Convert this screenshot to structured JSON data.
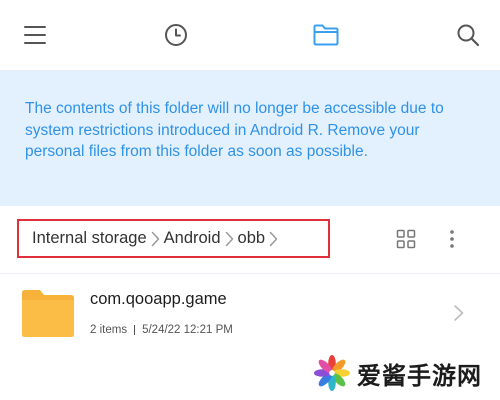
{
  "topbar": {
    "tabs": [
      {
        "icon": "menu-icon"
      },
      {
        "icon": "clock-icon"
      },
      {
        "icon": "folder-icon",
        "active": true
      },
      {
        "icon": "search-icon"
      }
    ],
    "accent_color": "#3aa0ee",
    "icon_color": "#555555"
  },
  "notice": {
    "text": "The contents of this folder will no longer be accessible due to system restrictions introduced in Android R. Remove your personal files from this folder as soon as possible.",
    "background": "#e3f0fd",
    "text_color": "#2f92e6"
  },
  "breadcrumb": {
    "items": [
      "Internal storage",
      "Android",
      "obb"
    ],
    "highlight_color": "#e0303a"
  },
  "toolbar": {
    "view_toggle_icon": "grid-view-icon",
    "more_icon": "more-vertical-icon"
  },
  "files": [
    {
      "name": "com.qooapp.game",
      "items": "2 items",
      "date": "5/24/22 12:21 PM",
      "icon": "folder-icon",
      "folder_color": "#f6b23a"
    }
  ],
  "watermark": {
    "text": "爱酱手游网",
    "logo": "pinwheel-logo"
  }
}
